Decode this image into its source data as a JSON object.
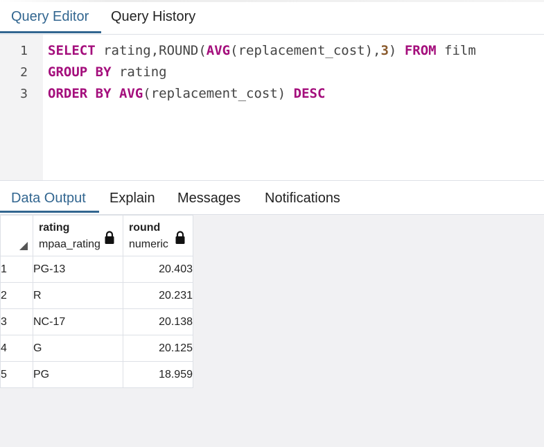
{
  "tabs": {
    "query_editor": "Query Editor",
    "query_history": "Query History"
  },
  "editor": {
    "line_numbers": [
      "1",
      "2",
      "3"
    ],
    "lines": [
      [
        {
          "t": "SELECT",
          "k": "kw"
        },
        {
          "t": " rating,ROUND(",
          "k": "plain"
        },
        {
          "t": "AVG",
          "k": "kw"
        },
        {
          "t": "(replacement_cost),",
          "k": "plain"
        },
        {
          "t": "3",
          "k": "num"
        },
        {
          "t": ") ",
          "k": "plain"
        },
        {
          "t": "FROM",
          "k": "kw"
        },
        {
          "t": " film",
          "k": "plain"
        }
      ],
      [
        {
          "t": "GROUP BY",
          "k": "kw"
        },
        {
          "t": " rating",
          "k": "plain"
        }
      ],
      [
        {
          "t": "ORDER BY",
          "k": "kw"
        },
        {
          "t": " ",
          "k": "plain"
        },
        {
          "t": "AVG",
          "k": "kw"
        },
        {
          "t": "(replacement_cost) ",
          "k": "plain"
        },
        {
          "t": "DESC",
          "k": "kw"
        }
      ]
    ]
  },
  "output_tabs": {
    "data_output": "Data Output",
    "explain": "Explain",
    "messages": "Messages",
    "notifications": "Notifications"
  },
  "grid": {
    "columns": [
      {
        "name": "rating",
        "type": "mpaa_rating",
        "icon": "lock-icon"
      },
      {
        "name": "round",
        "type": "numeric",
        "icon": "lock-icon"
      }
    ],
    "rows": [
      {
        "num": "1",
        "rating": "PG-13",
        "round": "20.403"
      },
      {
        "num": "2",
        "rating": "R",
        "round": "20.231"
      },
      {
        "num": "3",
        "rating": "NC-17",
        "round": "20.138"
      },
      {
        "num": "4",
        "rating": "G",
        "round": "20.125"
      },
      {
        "num": "5",
        "rating": "PG",
        "round": "18.959"
      }
    ]
  },
  "colors": {
    "accent": "#326690",
    "keyword": "#a40e7c",
    "number": "#8a5a2c",
    "gutter": "#f3f3f4",
    "grid_bg": "#f1f1f3"
  }
}
